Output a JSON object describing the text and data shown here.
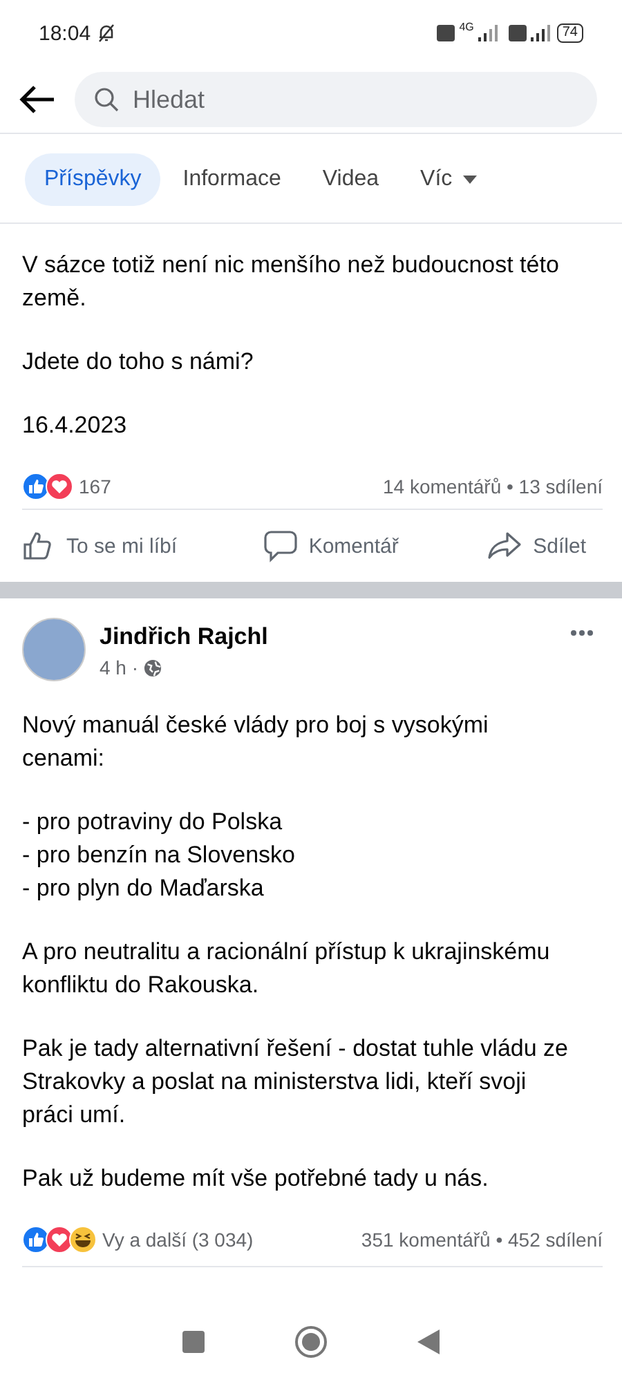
{
  "status_bar": {
    "time": "18:04",
    "network": "4G",
    "battery": "74"
  },
  "search": {
    "placeholder": "Hledat"
  },
  "tabs": [
    {
      "label": "Příspěvky",
      "selected": true
    },
    {
      "label": "Informace",
      "selected": false
    },
    {
      "label": "Videa",
      "selected": false
    },
    {
      "label": "Víc",
      "selected": false,
      "kind": "dropdown"
    }
  ],
  "posts": [
    {
      "paragraphs": [
        {
          "kind": "text",
          "text": "V sázce totiž není nic menšího než budoucnost této země."
        },
        {
          "kind": "text",
          "text": "Jdete do toho s námi?"
        },
        {
          "kind": "text",
          "text": "16.4.2023"
        }
      ],
      "reactions": [
        {
          "kind": "like"
        },
        {
          "kind": "love"
        }
      ],
      "reaction_count": "167",
      "stats": "14 komentářů • 13 sdílení",
      "actions": [
        {
          "kind": "like",
          "label": "To se mi líbí"
        },
        {
          "kind": "comment",
          "label": "Komentář"
        },
        {
          "kind": "share",
          "label": "Sdílet"
        }
      ]
    },
    {
      "author": "Jindřich Rajchl",
      "time": "4 h ·",
      "paragraphs": [
        {
          "kind": "text",
          "text": "Nový manuál české vlády pro boj s vysokými cenami:"
        },
        {
          "kind": "list",
          "items": [
            "- pro potraviny do Polska",
            "- pro benzín na Slovensko",
            "- pro plyn do Maďarska"
          ]
        },
        {
          "kind": "text",
          "text": "A pro neutralitu a racionální přístup k ukrajinskému konfliktu do Rakouska."
        },
        {
          "kind": "text",
          "text": "Pak je tady alternativní řešení - dostat tuhle vládu ze Strakovky a poslat na ministerstva lidi, kteří svoji práci umí."
        },
        {
          "kind": "text",
          "text": "Pak už budeme mít vše potřebné tady u nás."
        }
      ],
      "reactions": [
        {
          "kind": "like"
        },
        {
          "kind": "love"
        },
        {
          "kind": "haha"
        }
      ],
      "reaction_count": "Vy a další (3 034)",
      "stats": "351 komentářů • 452 sdílení"
    }
  ]
}
